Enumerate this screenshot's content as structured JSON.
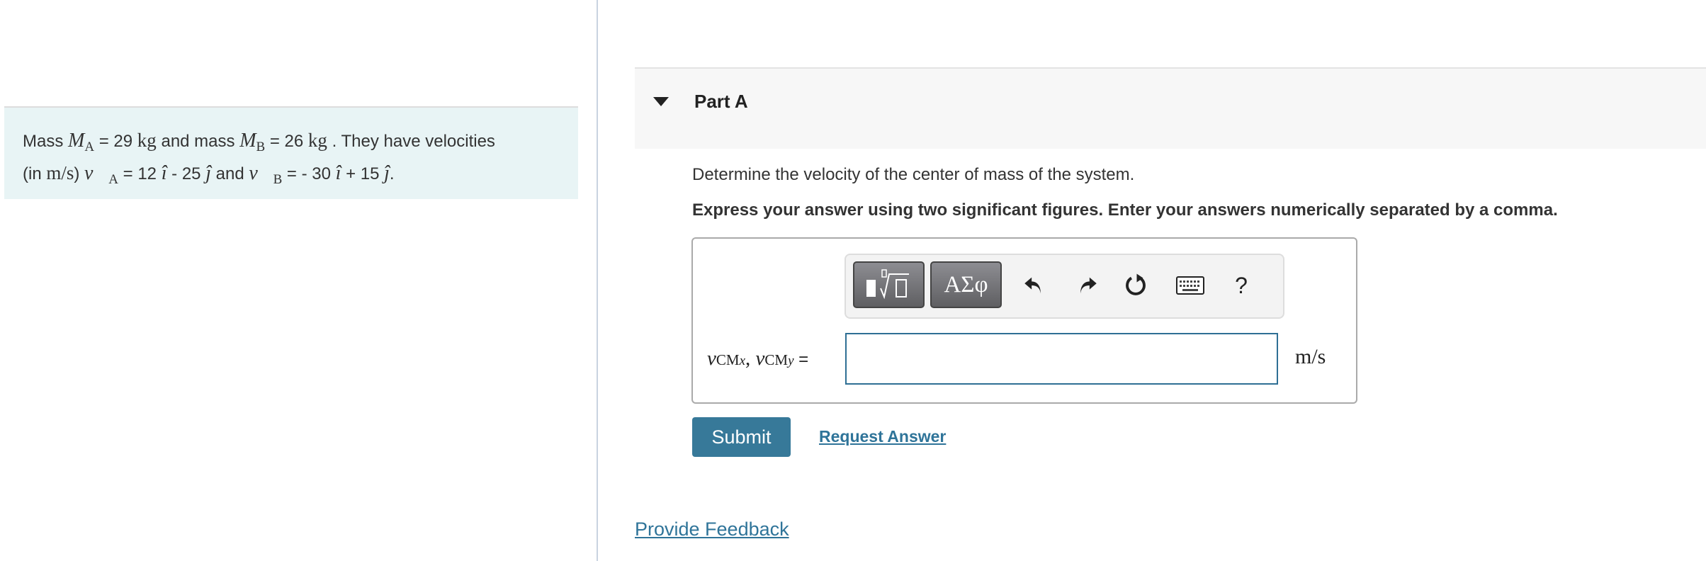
{
  "problem": {
    "t1": "Mass ",
    "ma": "M",
    "ma_sub": "A",
    "t2": " = 29 ",
    "kg1": "kg",
    "t3": " and mass ",
    "mb": "M",
    "mb_sub": "B",
    "t4": " = 26 ",
    "kg2": "kg",
    "t5": " . They have velocities",
    "t6": "(in ",
    "unit": "m/s",
    "t7": ") ",
    "va": "v⃗",
    "va_sub": "A",
    "t8": " = 12 ",
    "i1": "î",
    "t9": " - 25 ",
    "j1": "ĵ",
    "t10": " and ",
    "vb": "v⃗",
    "vb_sub": "B",
    "t11": " = - 30 ",
    "i2": "î",
    "t12": " + 15 ",
    "j2": "ĵ",
    "t13": "."
  },
  "part": {
    "title": "Part A",
    "expanded": true
  },
  "question": {
    "prompt": "Determine the velocity of the center of mass of the system.",
    "instructions": "Express your answer using two significant figures. Enter your answers numerically separated by a comma."
  },
  "toolbar": {
    "templates_icon": "fraction-root-templates-icon",
    "symbols_label": "ΑΣφ",
    "undo_icon": "undo-icon",
    "redo_icon": "redo-icon",
    "reset_icon": "reset-icon",
    "keyboard_icon": "keyboard-icon",
    "help_label": "?"
  },
  "answer": {
    "v1": "v",
    "s1": "CM",
    "x": "x",
    "comma": ", ",
    "v2": "v",
    "s2": "CM",
    "y": "y",
    "eq": " =",
    "value": "",
    "unit": "m/s"
  },
  "actions": {
    "submit": "Submit",
    "request": "Request Answer",
    "feedback": "Provide Feedback"
  },
  "colors": {
    "accent": "#377999",
    "problem_bg": "#e8f4f5",
    "link": "#2f7499"
  }
}
